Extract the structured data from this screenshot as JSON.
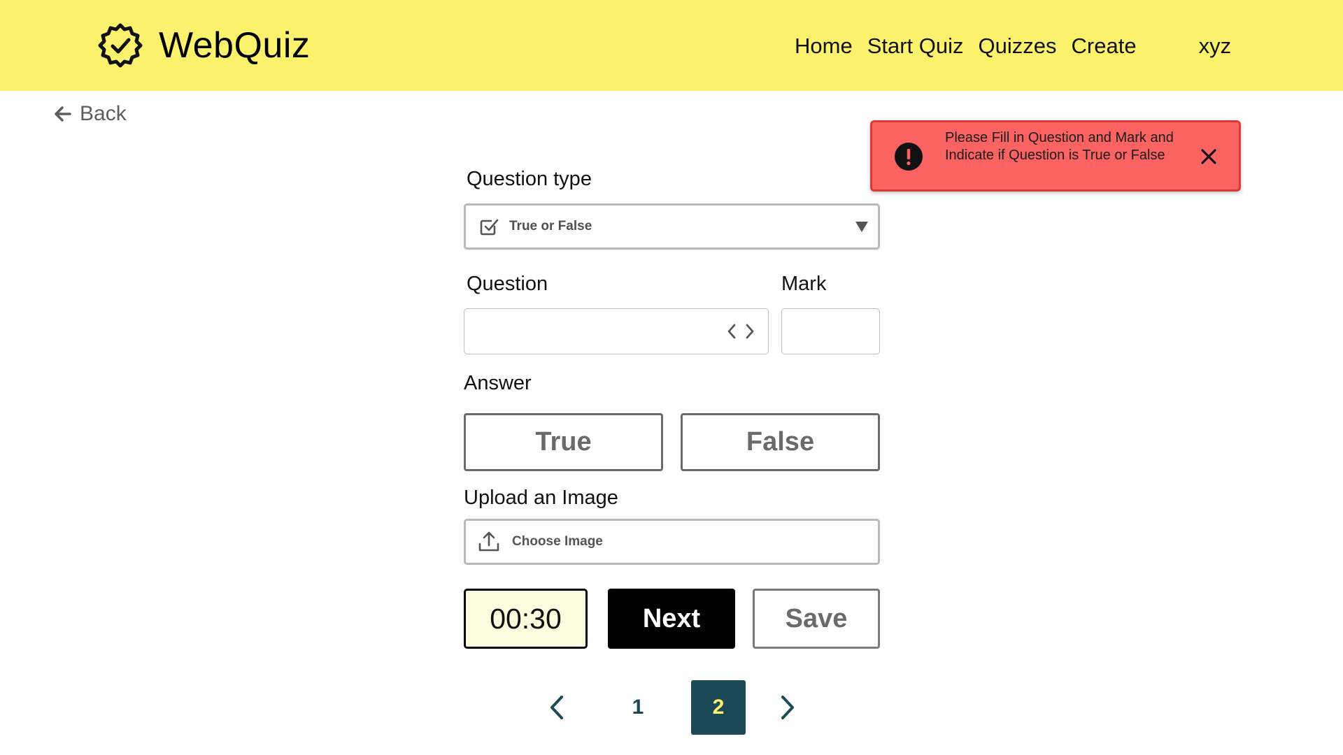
{
  "app": {
    "name": "WebQuiz",
    "logo_icon": "gear-check-icon"
  },
  "nav": {
    "items": [
      {
        "label": "Home"
      },
      {
        "label": "Start Quiz"
      },
      {
        "label": "Quizzes"
      },
      {
        "label": "Create"
      }
    ],
    "user": "xyz"
  },
  "back": {
    "label": "Back",
    "icon": "arrow-left-icon"
  },
  "toast": {
    "message": "Please Fill in Question and Mark and Indicate if Question is True or False",
    "icon": "error-icon",
    "close_icon": "close-icon",
    "bg_color": "#fb6363"
  },
  "form": {
    "question_type": {
      "label": "Question type",
      "selected": "True or False",
      "icon": "checkbox-icon"
    },
    "question": {
      "label": "Question",
      "value": "",
      "icon": "code-icon"
    },
    "mark": {
      "label": "Mark",
      "value": ""
    },
    "answer": {
      "label": "Answer",
      "true_label": "True",
      "false_label": "False"
    },
    "upload": {
      "label": "Upload an Image",
      "button_label": "Choose Image",
      "icon": "upload-icon"
    },
    "timer": "00:30",
    "next_label": "Next",
    "save_label": "Save"
  },
  "pagination": {
    "pages": [
      "1",
      "2"
    ],
    "current": "2"
  },
  "colors": {
    "header": "#fdf26e",
    "accent": "#1b4a56"
  }
}
